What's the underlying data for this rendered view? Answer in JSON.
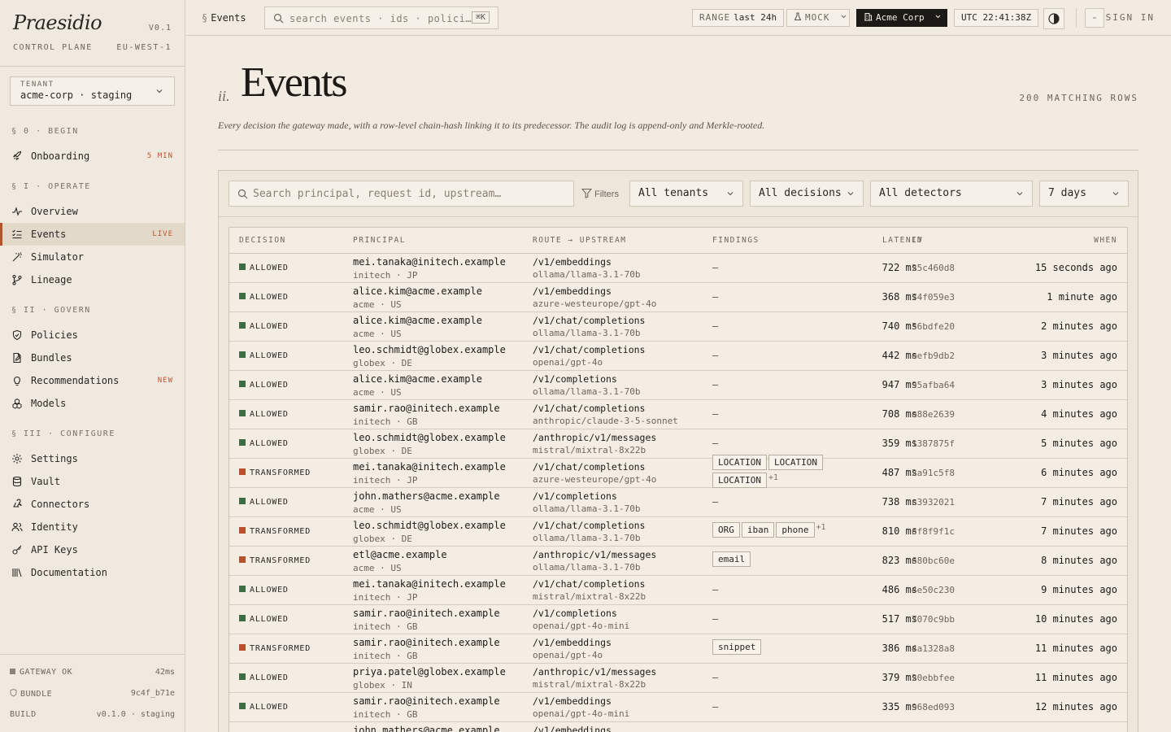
{
  "app": {
    "brand": "Praesidio",
    "version": "V0.1",
    "plane": "CONTROL PLANE",
    "region": "EU-WEST-1"
  },
  "tenant": {
    "label": "TENANT",
    "value": "acme-corp · staging"
  },
  "sidebar": {
    "sections": [
      {
        "title": "§ 0 · BEGIN"
      },
      {
        "title": "§ I · OPERATE"
      },
      {
        "title": "§ II · GOVERN"
      },
      {
        "title": "§ III · CONFIGURE"
      }
    ],
    "items": [
      {
        "label": "Onboarding",
        "badge": "5 MIN",
        "icon": "rocket-icon"
      },
      {
        "label": "Overview",
        "badge": "",
        "icon": "activity-icon"
      },
      {
        "label": "Events",
        "badge": "LIVE",
        "icon": "list-check-icon"
      },
      {
        "label": "Simulator",
        "badge": "",
        "icon": "wand-icon"
      },
      {
        "label": "Lineage",
        "badge": "",
        "icon": "git-branch-icon"
      },
      {
        "label": "Policies",
        "badge": "",
        "icon": "shield-icon"
      },
      {
        "label": "Bundles",
        "badge": "",
        "icon": "file-edit-icon"
      },
      {
        "label": "Recommendations",
        "badge": "NEW",
        "icon": "lightbulb-icon"
      },
      {
        "label": "Models",
        "badge": "",
        "icon": "boxes-icon"
      },
      {
        "label": "Settings",
        "badge": "",
        "icon": "gear-icon"
      },
      {
        "label": "Vault",
        "badge": "",
        "icon": "database-icon"
      },
      {
        "label": "Connectors",
        "badge": "",
        "icon": "webhook-icon"
      },
      {
        "label": "Identity",
        "badge": "",
        "icon": "users-icon"
      },
      {
        "label": "API Keys",
        "badge": "",
        "icon": "key-icon"
      },
      {
        "label": "Documentation",
        "badge": "",
        "icon": "library-icon"
      }
    ],
    "footer": {
      "gateway_label": "GATEWAY OK",
      "gateway_value": "42ms",
      "bundle_label": "BUNDLE",
      "bundle_value": "9c4f_b71e",
      "build_label": "BUILD",
      "build_value": "v0.1.0 · staging"
    }
  },
  "topbar": {
    "crumb": "Events",
    "search_placeholder": "search events · ids · polici…",
    "search_kbd": "⌘K",
    "range_label": "RANGE",
    "range_value": "last 24h",
    "mode": "MOCK",
    "org": "Acme Corp",
    "clock": "UTC 22:41:38Z",
    "signin": "SIGN IN"
  },
  "page": {
    "num": "ii.",
    "title": "Events",
    "count": "200 MATCHING ROWS",
    "description": "Every decision the gateway made, with a row-level chain-hash linking it to its predecessor. The audit log is append-only and Merkle-rooted."
  },
  "filters": {
    "search_placeholder": "Search principal, request id, upstream…",
    "filters_label": "Filters",
    "tenants": "All tenants",
    "decisions": "All decisions",
    "detectors": "All detectors",
    "days": "7 days"
  },
  "table": {
    "headers": {
      "decision": "DECISION",
      "principal": "PRINCIPAL",
      "route": "ROUTE → UPSTREAM",
      "findings": "FINDINGS",
      "latency": "LATENCY",
      "id": "ID",
      "when": "WHEN"
    },
    "rows": [
      {
        "decision": "ALLOWED",
        "principal": "mei.tanaka@initech.example",
        "meta": "initech · JP",
        "route": "/v1/embeddings",
        "upstream": "ollama/llama-3.1-70b",
        "findings": [],
        "more": "",
        "latency": "722",
        "unit": "ms",
        "id": "25c460d8",
        "when": "15 seconds ago"
      },
      {
        "decision": "ALLOWED",
        "principal": "alice.kim@acme.example",
        "meta": "acme · US",
        "route": "/v1/embeddings",
        "upstream": "azure-westeurope/gpt-4o",
        "findings": [],
        "more": "",
        "latency": "368",
        "unit": "ms",
        "id": "74f059e3",
        "when": "1 minute ago"
      },
      {
        "decision": "ALLOWED",
        "principal": "alice.kim@acme.example",
        "meta": "acme · US",
        "route": "/v1/chat/completions",
        "upstream": "ollama/llama-3.1-70b",
        "findings": [],
        "more": "",
        "latency": "740",
        "unit": "ms",
        "id": "56bdfe20",
        "when": "2 minutes ago"
      },
      {
        "decision": "ALLOWED",
        "principal": "leo.schmidt@globex.example",
        "meta": "globex · DE",
        "route": "/v1/chat/completions",
        "upstream": "openai/gpt-4o",
        "findings": [],
        "more": "",
        "latency": "442",
        "unit": "ms",
        "id": "eefb9db2",
        "when": "3 minutes ago"
      },
      {
        "decision": "ALLOWED",
        "principal": "alice.kim@acme.example",
        "meta": "acme · US",
        "route": "/v1/completions",
        "upstream": "ollama/llama-3.1-70b",
        "findings": [],
        "more": "",
        "latency": "947",
        "unit": "ms",
        "id": "95afba64",
        "when": "3 minutes ago"
      },
      {
        "decision": "ALLOWED",
        "principal": "samir.rao@initech.example",
        "meta": "initech · GB",
        "route": "/v1/chat/completions",
        "upstream": "anthropic/claude-3-5-sonnet",
        "findings": [],
        "more": "",
        "latency": "708",
        "unit": "ms",
        "id": "e88e2639",
        "when": "4 minutes ago"
      },
      {
        "decision": "ALLOWED",
        "principal": "leo.schmidt@globex.example",
        "meta": "globex · DE",
        "route": "/anthropic/v1/messages",
        "upstream": "mistral/mixtral-8x22b",
        "findings": [],
        "more": "",
        "latency": "359",
        "unit": "ms",
        "id": "1387875f",
        "when": "5 minutes ago"
      },
      {
        "decision": "TRANSFORMED",
        "principal": "mei.tanaka@initech.example",
        "meta": "initech · JP",
        "route": "/v1/chat/completions",
        "upstream": "azure-westeurope/gpt-4o",
        "findings": [
          "LOCATION",
          "LOCATION",
          "LOCATION"
        ],
        "more": "+1",
        "latency": "487",
        "unit": "ms",
        "id": "2a91c5f8",
        "when": "6 minutes ago"
      },
      {
        "decision": "ALLOWED",
        "principal": "john.mathers@acme.example",
        "meta": "acme · US",
        "route": "/v1/completions",
        "upstream": "ollama/llama-3.1-70b",
        "findings": [],
        "more": "",
        "latency": "738",
        "unit": "ms",
        "id": "c3932021",
        "when": "7 minutes ago"
      },
      {
        "decision": "TRANSFORMED",
        "principal": "leo.schmidt@globex.example",
        "meta": "globex · DE",
        "route": "/v1/chat/completions",
        "upstream": "ollama/llama-3.1-70b",
        "findings": [
          "ORG",
          "iban",
          "phone"
        ],
        "more": "+1",
        "latency": "810",
        "unit": "ms",
        "id": "6f8f9f1c",
        "when": "7 minutes ago"
      },
      {
        "decision": "TRANSFORMED",
        "principal": "etl@acme.example",
        "meta": "acme · US",
        "route": "/anthropic/v1/messages",
        "upstream": "ollama/llama-3.1-70b",
        "findings": [
          "email"
        ],
        "more": "",
        "latency": "823",
        "unit": "ms",
        "id": "680bc60e",
        "when": "8 minutes ago"
      },
      {
        "decision": "ALLOWED",
        "principal": "mei.tanaka@initech.example",
        "meta": "initech · JP",
        "route": "/v1/chat/completions",
        "upstream": "mistral/mixtral-8x22b",
        "findings": [],
        "more": "",
        "latency": "486",
        "unit": "ms",
        "id": "4e50c230",
        "when": "9 minutes ago"
      },
      {
        "decision": "ALLOWED",
        "principal": "samir.rao@initech.example",
        "meta": "initech · GB",
        "route": "/v1/completions",
        "upstream": "openai/gpt-4o-mini",
        "findings": [],
        "more": "",
        "latency": "517",
        "unit": "ms",
        "id": "7070c9bb",
        "when": "10 minutes ago"
      },
      {
        "decision": "TRANSFORMED",
        "principal": "samir.rao@initech.example",
        "meta": "initech · GB",
        "route": "/v1/embeddings",
        "upstream": "openai/gpt-4o",
        "findings": [
          "snippet"
        ],
        "more": "",
        "latency": "386",
        "unit": "ms",
        "id": "4a1328a8",
        "when": "11 minutes ago"
      },
      {
        "decision": "ALLOWED",
        "principal": "priya.patel@globex.example",
        "meta": "globex · IN",
        "route": "/anthropic/v1/messages",
        "upstream": "mistral/mixtral-8x22b",
        "findings": [],
        "more": "",
        "latency": "379",
        "unit": "ms",
        "id": "20ebbfee",
        "when": "11 minutes ago"
      },
      {
        "decision": "ALLOWED",
        "principal": "samir.rao@initech.example",
        "meta": "initech · GB",
        "route": "/v1/embeddings",
        "upstream": "openai/gpt-4o-mini",
        "findings": [],
        "more": "",
        "latency": "335",
        "unit": "ms",
        "id": "968ed093",
        "when": "12 minutes ago"
      },
      {
        "decision": "",
        "principal": "john.mathers@acme.example",
        "meta": "",
        "route": "/v1/embeddings",
        "upstream": "",
        "findings": [],
        "more": "",
        "latency": "",
        "unit": "",
        "id": "",
        "when": ""
      }
    ],
    "empty_findings": "–"
  },
  "colors": {
    "allowed": "#3f6b45",
    "transformed": "#b4532a",
    "accent": "#b4532a"
  }
}
